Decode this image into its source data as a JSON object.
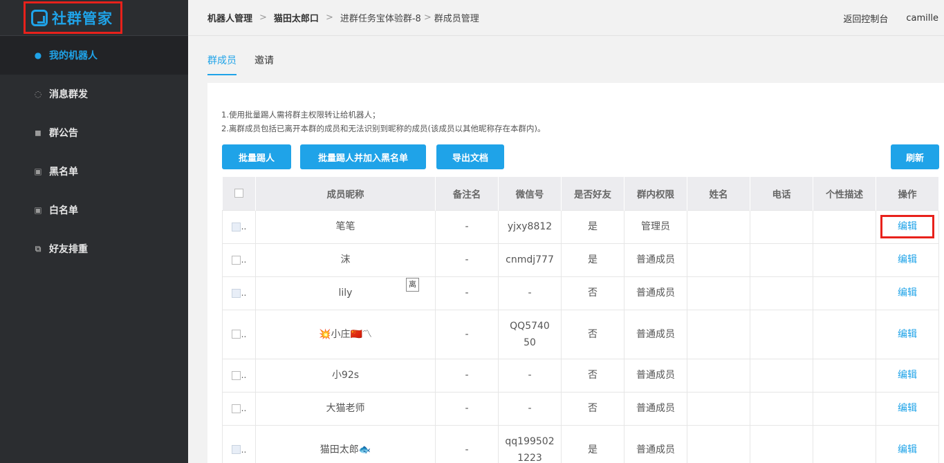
{
  "sidebar": {
    "logo_text": "社群管家",
    "items": [
      {
        "label": "我的机器人",
        "icon": "user-circle-icon",
        "active": true
      },
      {
        "label": "消息群发",
        "icon": "chat-bubble-icon"
      },
      {
        "label": "群公告",
        "icon": "megaphone-icon"
      },
      {
        "label": "黑名单",
        "icon": "id-card-icon"
      },
      {
        "label": "白名单",
        "icon": "id-card-icon"
      },
      {
        "label": "好友排重",
        "icon": "copy-icon"
      }
    ]
  },
  "header": {
    "breadcrumb": [
      "机器人管理",
      "猫田太郎口",
      "进群任务宝体验群-8",
      "群成员管理"
    ],
    "back_label": "返回控制台",
    "user": "camille"
  },
  "tabs": [
    {
      "label": "群成员",
      "active": true
    },
    {
      "label": "邀请"
    }
  ],
  "notes": [
    "1.使用批量踢人需将群主权限转让给机器人；",
    "2.离群成员包括已离开本群的成员和无法识别到昵称的成员(该成员以其他昵称存在本群内)。"
  ],
  "buttons": {
    "batch_kick": "批量踢人",
    "batch_kick_blacklist": "批量踢人并加入黑名单",
    "export": "导出文档",
    "refresh": "刷新"
  },
  "table": {
    "columns": [
      "成员昵称",
      "备注名",
      "微信号",
      "是否好友",
      "群内权限",
      "姓名",
      "电话",
      "个性描述",
      "操作"
    ],
    "left_tag": "离",
    "rows": [
      {
        "nick": "笔笔",
        "remark": "-",
        "wechat": "yjxy8812",
        "friend": "是",
        "role": "管理员",
        "name": "",
        "phone": "",
        "desc": "",
        "action": "编辑"
      },
      {
        "nick": "沫",
        "remark": "-",
        "wechat": "cnmdj777",
        "friend": "是",
        "role": "普通成员",
        "name": "",
        "phone": "",
        "desc": "",
        "action": "编辑"
      },
      {
        "nick": "lily",
        "remark": "-",
        "wechat": "-",
        "friend": "否",
        "role": "普通成员",
        "name": "",
        "phone": "",
        "desc": "",
        "action": "编辑"
      },
      {
        "nick": "💥小庄🇨🇳〽",
        "remark": "-",
        "wechat": "QQ574050",
        "friend": "否",
        "role": "普通成员",
        "name": "",
        "phone": "",
        "desc": "",
        "action": "编辑"
      },
      {
        "nick": "小92s",
        "remark": "-",
        "wechat": "-",
        "friend": "否",
        "role": "普通成员",
        "name": "",
        "phone": "",
        "desc": "",
        "action": "编辑"
      },
      {
        "nick": "大猫老师",
        "remark": "-",
        "wechat": "-",
        "friend": "否",
        "role": "普通成员",
        "name": "",
        "phone": "",
        "desc": "",
        "action": "编辑"
      },
      {
        "nick": "猫田太郎🐟",
        "remark": "-",
        "wechat": "qq1995021223",
        "friend": "是",
        "role": "普通成员",
        "name": "",
        "phone": "",
        "desc": "",
        "action": "编辑"
      }
    ]
  },
  "colors": {
    "accent": "#1fa3e8",
    "sidebar_bg": "#2b2d30",
    "highlight": "#e8211b"
  }
}
